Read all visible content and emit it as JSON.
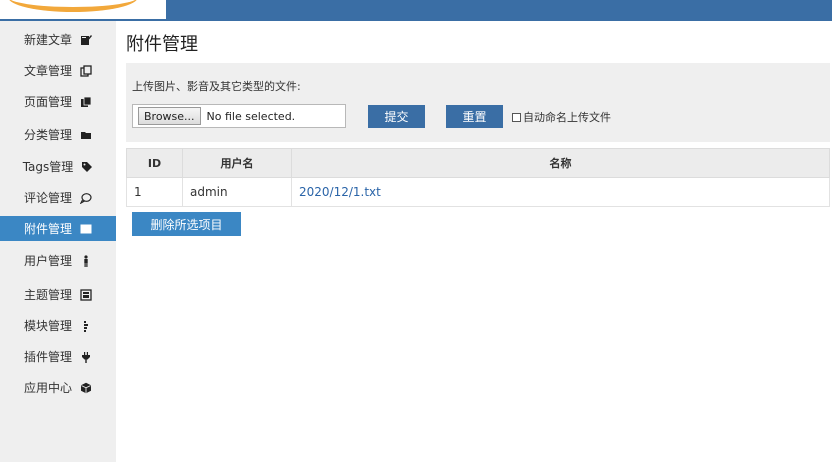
{
  "colors": {
    "accent": "#3a6ea5",
    "active": "#3b87c4",
    "sidebar_bg": "#efefef"
  },
  "sidebar": {
    "items": [
      {
        "label": "新建文章",
        "icon": "edit-icon",
        "active": false
      },
      {
        "label": "文章管理",
        "icon": "copy-icon",
        "active": false
      },
      {
        "label": "页面管理",
        "icon": "pages-icon",
        "active": false
      },
      {
        "label": "分类管理",
        "icon": "folder-icon",
        "active": false
      },
      {
        "label": "Tags管理",
        "icon": "tag-icon",
        "active": false
      },
      {
        "label": "评论管理",
        "icon": "comment-icon",
        "active": false
      },
      {
        "label": "附件管理",
        "icon": "hdd-icon",
        "active": true
      },
      {
        "label": "用户管理",
        "icon": "user-icon",
        "active": false
      },
      {
        "label": "主题管理",
        "icon": "theme-icon",
        "active": false
      },
      {
        "label": "模块管理",
        "icon": "module-icon",
        "active": false
      },
      {
        "label": "插件管理",
        "icon": "plug-icon",
        "active": false
      },
      {
        "label": "应用中心",
        "icon": "box-icon",
        "active": false
      }
    ]
  },
  "main": {
    "title": "附件管理",
    "upload": {
      "description": "上传图片、影音及其它类型的文件:",
      "browse_label": "Browse...",
      "file_status": "No file selected.",
      "submit_label": "提交",
      "reset_label": "重置",
      "auto_rename_label": "自动命名上传文件",
      "auto_rename_checked": false
    },
    "table": {
      "headers": {
        "id": "ID",
        "user": "用户名",
        "name": "名称"
      },
      "rows": [
        {
          "id": "1",
          "user": "admin",
          "name": "2020/12/1.txt"
        }
      ]
    },
    "delete_label": "删除所选项目"
  }
}
